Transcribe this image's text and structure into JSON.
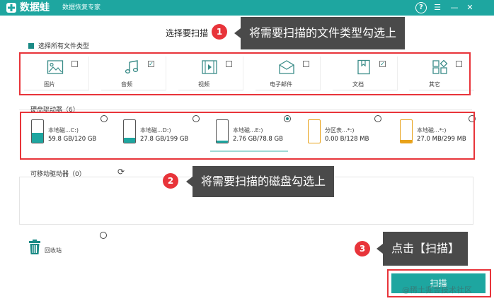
{
  "titlebar": {
    "app_name": "数据蛙",
    "app_subtitle": "数据恢复专家",
    "help_label": "?",
    "menu_label": "☰",
    "minimize_label": "—",
    "close_label": "✕",
    "color": "#1ea6a0"
  },
  "main": {
    "title": "选择要扫描",
    "select_all_label": "选择所有文件类型",
    "file_types": [
      {
        "label": "图片",
        "checked": false,
        "icon": "image-icon"
      },
      {
        "label": "音频",
        "checked": true,
        "icon": "music-icon"
      },
      {
        "label": "视频",
        "checked": false,
        "icon": "video-icon"
      },
      {
        "label": "电子邮件",
        "checked": false,
        "icon": "email-icon"
      },
      {
        "label": "文档",
        "checked": true,
        "icon": "document-icon"
      },
      {
        "label": "其它",
        "checked": false,
        "icon": "other-icon"
      }
    ],
    "hard_drives_header": "硬盘驱动器（6）",
    "drives": [
      {
        "name": "本地磁...C:)",
        "size": "59.8 GB/120 GB",
        "selected": false
      },
      {
        "name": "本地磁...D:)",
        "size": "27.8 GB/199 GB",
        "selected": false
      },
      {
        "name": "本地磁...E:)",
        "size": "2.76 GB/78.8 GB",
        "selected": true
      },
      {
        "name": "分区表...*:)",
        "size": "0.00  B/128 MB",
        "selected": false
      },
      {
        "name": "本地磁...*:)",
        "size": "27.0 MB/299 MB",
        "selected": false
      }
    ],
    "removable_header": "可移动驱动器（0）",
    "recycle_bin_label": "回收站",
    "scan_button_label": "扫描"
  },
  "annotations": [
    {
      "number": "1",
      "text": "将需要扫描的文件类型勾选上"
    },
    {
      "number": "2",
      "text": "将需要扫描的磁盘勾选上"
    },
    {
      "number": "3",
      "text": "点击【扫描】"
    }
  ],
  "watermark": "@稀土掘金技术社区",
  "colors": {
    "accent": "#1ea6a0",
    "highlight": "#e8343a",
    "callout": "#4a4a4a"
  }
}
